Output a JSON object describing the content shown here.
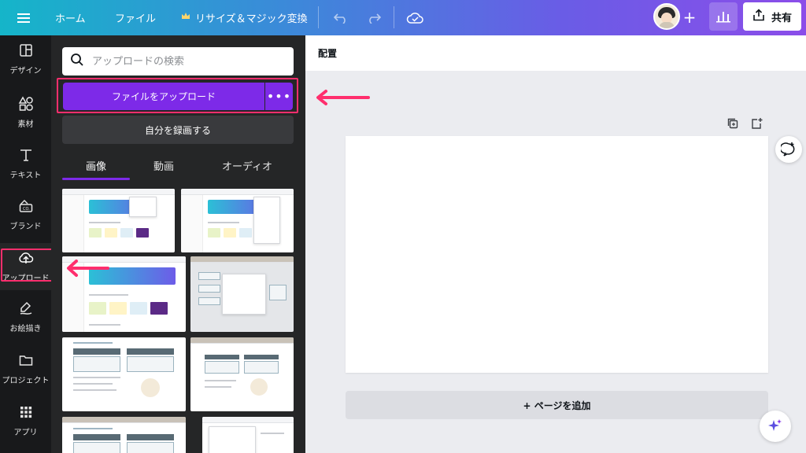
{
  "topbar": {
    "menu_icon": "hamburger-icon",
    "home": "ホーム",
    "file": "ファイル",
    "resize": "リサイズ＆マジック変換",
    "share": "共有",
    "gradient": [
      "#15b5c9",
      "#8b4de9"
    ]
  },
  "rail": {
    "items": [
      {
        "label": "デザイン",
        "icon": "layout-icon"
      },
      {
        "label": "素材",
        "icon": "shapes-icon"
      },
      {
        "label": "テキスト",
        "icon": "text-icon"
      },
      {
        "label": "ブランド",
        "icon": "brand-icon"
      },
      {
        "label": "アップロード",
        "icon": "cloud-upload-icon"
      },
      {
        "label": "お絵描き",
        "icon": "draw-icon"
      },
      {
        "label": "プロジェクト",
        "icon": "folder-icon"
      },
      {
        "label": "アプリ",
        "icon": "apps-grid-icon"
      }
    ],
    "active": "アップロード"
  },
  "panel": {
    "search_placeholder": "アップロードの検索",
    "upload_button": "ファイルをアップロード",
    "more_button": "•••",
    "record_button": "自分を録画する",
    "tabs": [
      "画像",
      "動画",
      "オーディオ"
    ],
    "active_tab": "画像",
    "accent": "#7d2ae8"
  },
  "canvas": {
    "heading": "配置",
    "add_page": "+ ページを追加"
  },
  "highlight_color": "#ff2e6d"
}
